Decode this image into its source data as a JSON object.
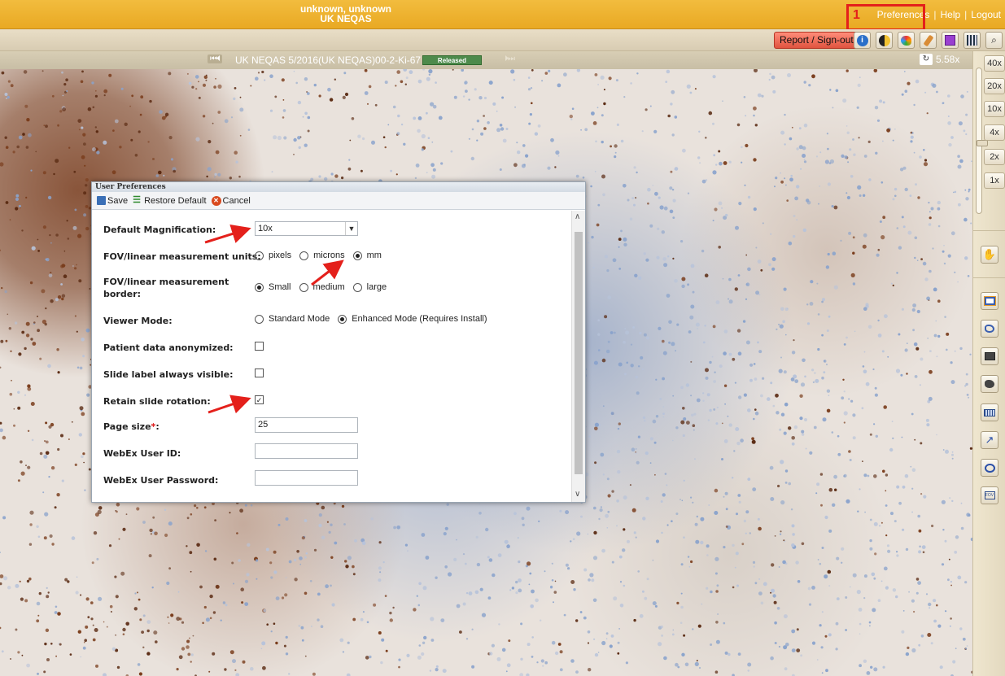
{
  "header": {
    "user_name": "unknown, unknown",
    "organization": "UK NEQAS",
    "annotation_number": "1",
    "links": [
      {
        "label": "Preferences"
      },
      {
        "label": "Help"
      },
      {
        "label": "Logout"
      }
    ]
  },
  "toolbar": {
    "report_label": "Report / Sign-out",
    "icons": [
      "info-icon",
      "contrast-icon",
      "palette-icon",
      "brush-icon",
      "purple-square-icon",
      "grid-icon",
      "search-icon"
    ]
  },
  "slide": {
    "title": "UK NEQAS 5/2016(UK NEQAS)00-2-Ki-67",
    "status": "Released",
    "nav_prev": "⏮⏴",
    "nav_next": "⏵⏭",
    "zoom": "5.58x"
  },
  "magnification": {
    "levels": [
      "40x",
      "20x",
      "10x",
      "4x",
      "2x",
      "1x"
    ]
  },
  "tools": [
    "pan-hand-icon",
    "rectangle-icon",
    "freehand-icon",
    "filled-rectangle-icon",
    "filled-freehand-icon",
    "ruler-icon",
    "arrow-icon",
    "ellipse-icon",
    "fov-icon"
  ],
  "dialog": {
    "title": "User Preferences",
    "save_label": "Save",
    "restore_label": "Restore Default",
    "cancel_label": "Cancel",
    "fields": {
      "default_magnification": {
        "label": "Default Magnification:",
        "value": "10x"
      },
      "units": {
        "label": "FOV/linear measurement units:",
        "options": [
          "pixels",
          "microns",
          "mm"
        ],
        "selected": "mm"
      },
      "border": {
        "label_line1": "FOV/linear measurement",
        "label_line2": "border:",
        "options": [
          "Small",
          "medium",
          "large"
        ],
        "selected": "Small"
      },
      "viewer_mode": {
        "label": "Viewer Mode:",
        "options": [
          "Standard Mode",
          "Enhanced Mode (Requires Install)"
        ],
        "selected": "Enhanced Mode (Requires Install)"
      },
      "anonymized": {
        "label": "Patient data anonymized:",
        "checked": false
      },
      "label_visible": {
        "label": "Slide label always visible:",
        "checked": false
      },
      "retain_rotation": {
        "label": "Retain slide rotation:",
        "checked": true
      },
      "page_size": {
        "label": "Page size",
        "required_mark": "*",
        "colon": ":",
        "value": "25"
      },
      "webex_id": {
        "label": "WebEx User ID:",
        "value": ""
      },
      "webex_password": {
        "label": "WebEx User Password:",
        "value": ""
      }
    }
  },
  "colors": {
    "header": "#eeb232",
    "annotation": "#e4201b",
    "report_button": "#ef6b55",
    "released_badge": "#4d8a4b"
  }
}
